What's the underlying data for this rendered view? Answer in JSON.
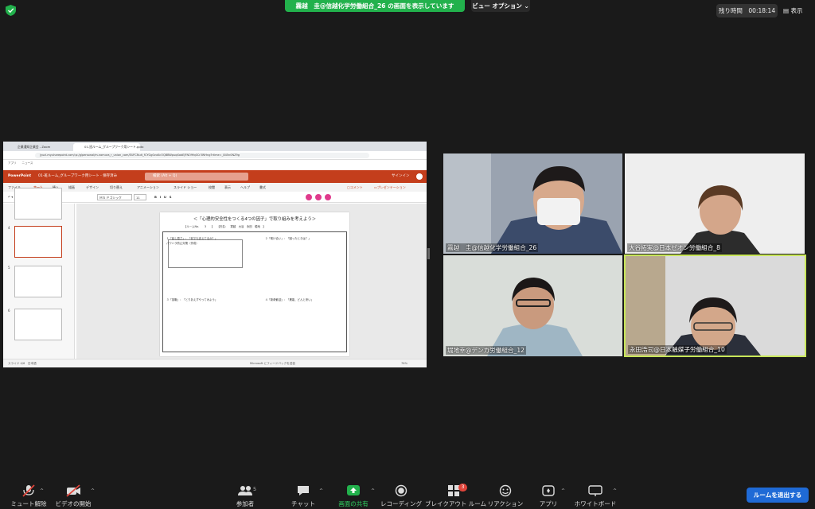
{
  "top": {
    "share_banner": "霧越　圭@信越化学労働組合_26 の画面を表示しています",
    "view_options": "ビュー オプション ⌄",
    "timer_label": "残り時間",
    "timer_value": "00:18:14",
    "view_label": "表示"
  },
  "shared": {
    "tab1": "企業通知企業会 - Zoom",
    "tab2": "01-班ルーム_グループワーク用シート.pptx",
    "url": "jyuzi-my.sharepoint.com/:p:/g/personal/m-nomura_r_union_com/EUFCNuit_fCYGg0vuKcOQBBWpuqXobEJFNO9fq0Cr3WHng?rtime=_845n0NZ9g",
    "bookmarks": "アプリ　　ニュース",
    "ppt_app": "PowerPoint",
    "ppt_file": "01-班ルーム_グループワーク用シート - 保存済み",
    "ppt_search": "検索 (Alt + Q)",
    "ppt_signin": "サインイン",
    "menus": [
      "ファイル",
      "ホーム",
      "挿入",
      "描画",
      "デザイン",
      "切り替え",
      "アニメーション",
      "スライド ショー",
      "校閲",
      "表示",
      "ヘルプ",
      "書式"
    ],
    "ribbon_font": "ＭＳ Ｐゴシック",
    "ribbon_size": "11",
    "comment_label": "コメント",
    "present_label": "プレゼンテーション",
    "slide_nums": [
      "4",
      "5",
      "6"
    ],
    "slide_title": "＜「心理的安全性をつくる4つの因子」で取り組みを考えよう＞",
    "slide_meta": "【ルームNo.　　3　　】　　【氏名：　霧越　大谷　永田　堀地　】",
    "q1": "１「話し易さ」：「何でも言えてるか？」",
    "q1_note": "パワハラ防止対策（作成）",
    "q2": "２「助け合い」：「困ったときは？」",
    "q3": "３「挑戦」：「とりあえずやってみよう」",
    "q4": "４「新奇歓迎」：「異能、どんと来い」",
    "status_slide": "スライド 4/6　日本語",
    "status_feedback": "Microsoft にフィードバックを送信",
    "status_zoom": "76%"
  },
  "participants": [
    {
      "name": "霧越　圭@信越化学労働組合_26"
    },
    {
      "name": "大谷拓実@日本ゼオン労働組合_8"
    },
    {
      "name": "堀地幸@デンカ労働組合_12"
    },
    {
      "name": "永田浩司@日本触媒子労働組合_10"
    }
  ],
  "toolbar": {
    "mute": "ミュート解除",
    "video": "ビデオの開始",
    "participants": "参加者",
    "participants_count": "5",
    "chat": "チャット",
    "share": "画面の共有",
    "record": "レコーディング",
    "breakout": "ブレイクアウト ルーム",
    "breakout_badge": "3",
    "reaction": "リアクション",
    "apps": "アプリ",
    "whiteboard": "ホワイトボード",
    "leave": "ルームを退出する"
  },
  "colors": {
    "accent_green": "#22b14c",
    "ppt_red": "#c43e1c",
    "active_speaker": "#c8e65a",
    "leave_blue": "#1f6ad6"
  }
}
